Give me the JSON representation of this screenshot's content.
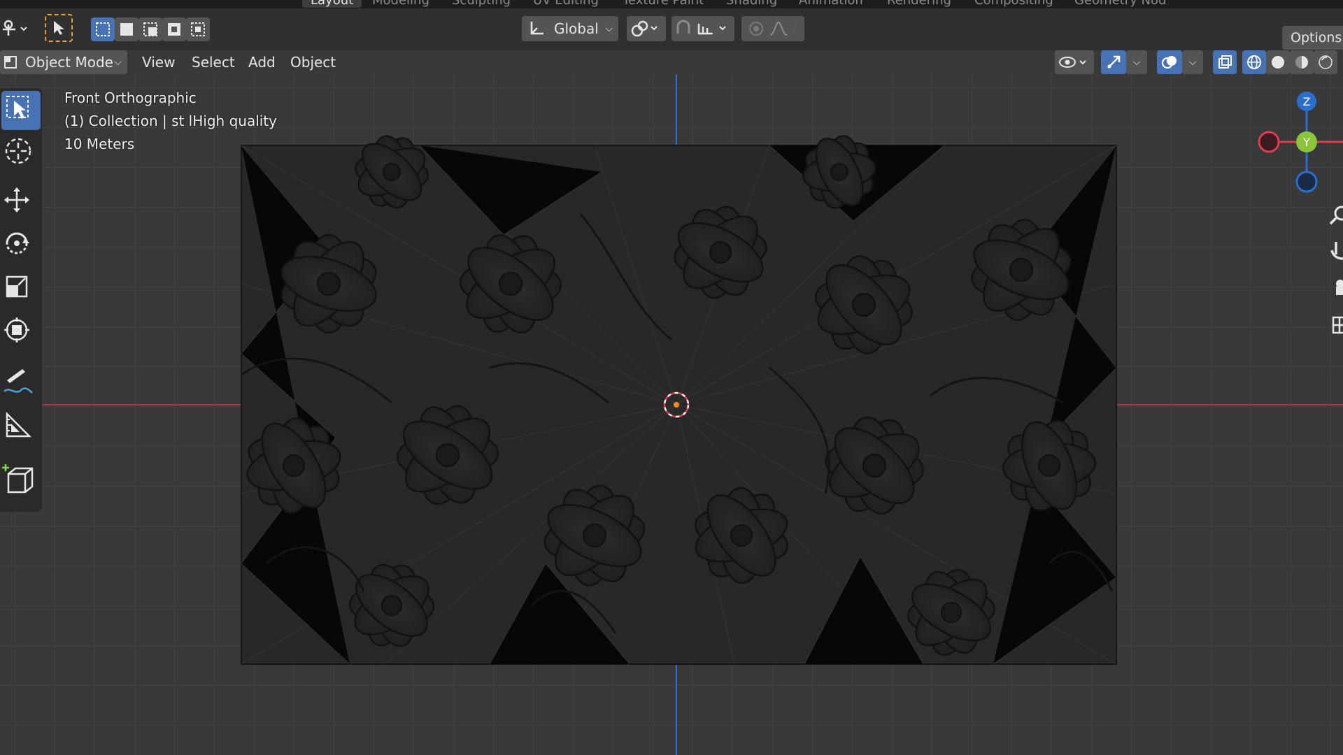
{
  "workspace_tabs": [
    "Layout",
    "Modeling",
    "Sculpting",
    "UV Editing",
    "Texture Paint",
    "Shading",
    "Animation",
    "Rendering",
    "Compositing",
    "Geometry Nod"
  ],
  "tool_header": {
    "transform_orientation": "Global",
    "options_label": "Options"
  },
  "viewport_header": {
    "mode": "Object Mode",
    "menus": [
      "View",
      "Select",
      "Add",
      "Object"
    ]
  },
  "overlay": {
    "view_name": "Front Orthographic",
    "collection": "(1) Collection | st lHigh quality",
    "scale": "10 Meters"
  },
  "gizmo": {
    "z_label": "Z",
    "y_label": "Y"
  },
  "colors": {
    "active_blue": "#4772b3",
    "x_axis_red": "#e23c4f",
    "z_axis_blue": "#2a6fd0",
    "y_axis_green": "#8bc33a",
    "origin_orange": "#ff8c1a"
  },
  "icons": [
    "select-box-icon",
    "cursor-icon",
    "move-icon",
    "rotate-icon",
    "scale-icon",
    "transform-icon",
    "annotate-icon",
    "measure-icon",
    "add-cube-icon"
  ]
}
